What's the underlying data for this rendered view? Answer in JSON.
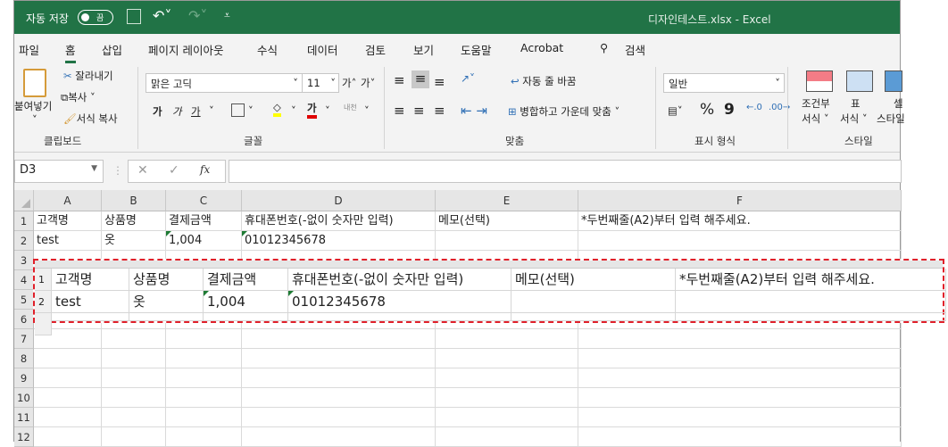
{
  "titlebar": {
    "autosave": "자동 저장",
    "toggle": "끔",
    "title": "디자인테스트.xlsx  -  Excel"
  },
  "tabs": [
    "파일",
    "홈",
    "삽입",
    "페이지 레이아웃",
    "수식",
    "데이터",
    "검토",
    "보기",
    "도움말",
    "Acrobat"
  ],
  "search": "검색",
  "ribbon": {
    "clipboard": {
      "paste": "붙여넣기",
      "cut": "잘라내기",
      "copy": "복사",
      "format_painter": "서식 복사",
      "group": "클립보드"
    },
    "font": {
      "name": "맑은 고딕",
      "size": "11",
      "grow": "가",
      "shrink": "가",
      "bold": "가",
      "italic": "가",
      "underline": "가",
      "font_color": "가",
      "phonetic": "내천",
      "group": "글꼴"
    },
    "alignment": {
      "wrap": "자동 줄 바꿈",
      "merge": "병합하고 가운데 맞춤",
      "group": "맞춤"
    },
    "number": {
      "format": "일반",
      "percent": "%",
      "comma": "9",
      "group": "표시 형식"
    },
    "styles": {
      "conditional": "조건부",
      "conditional2": "서식",
      "table": "표",
      "table2": "서식",
      "cell": "셀",
      "cell2": "스타일",
      "group": "스타일"
    },
    "colors": {
      "fill": "#ffff00",
      "font": "#e00000",
      "accent": "#217346"
    }
  },
  "namebox": "D3",
  "fx": "fx",
  "columns": [
    "A",
    "B",
    "C",
    "D",
    "E",
    "F"
  ],
  "rows": [
    "1",
    "2",
    "3",
    "4",
    "5",
    "6",
    "7",
    "8",
    "9",
    "10",
    "11",
    "12"
  ],
  "sheet": {
    "header": [
      "고객명",
      "상품명",
      "결제금액",
      "휴대폰번호(-없이 숫자만 입력)",
      "메모(선택)",
      "*두번째줄(A2)부터 입력 해주세요."
    ],
    "row2": [
      "test",
      "옷",
      "1,004",
      "01012345678",
      "",
      ""
    ]
  },
  "overlay": {
    "row_labels": [
      "1",
      "2"
    ],
    "header": [
      "고객명",
      "상품명",
      "결제금액",
      "휴대폰번호(-없이 숫자만 입력)",
      "메모(선택)",
      "*두번째줄(A2)부터 입력 해주세요."
    ],
    "row2": [
      "test",
      "옷",
      "1,004",
      "01012345678",
      "",
      ""
    ],
    "border_color": "#e0202a"
  }
}
